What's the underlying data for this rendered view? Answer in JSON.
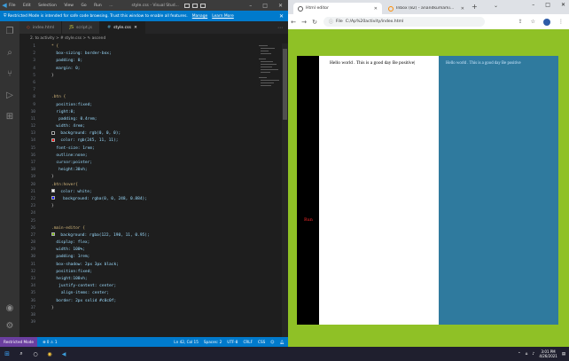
{
  "vscode": {
    "menu": [
      "File",
      "Edit",
      "Selection",
      "View",
      "Go",
      "Run",
      "..."
    ],
    "window_title": "style.css - Visual Stud...",
    "banner_text": "Restricted Mode is intended for safe code browsing. Trust this window to enable all features.",
    "banner_links": [
      "Manage",
      "Learn More"
    ],
    "tabs": [
      {
        "label": "index.html",
        "icon": "html-file-icon"
      },
      {
        "label": "script.js",
        "icon": "js-file-icon"
      },
      {
        "label": "style.css",
        "icon": "css-file-icon"
      }
    ],
    "breadcrumb": "2. to activity > # style.css > ✎ ascend",
    "code": [
      {
        "n": "1",
        "t": "* {",
        "k": "sel"
      },
      {
        "n": "2",
        "t": "  box-sizing: border-box;",
        "k": "prop"
      },
      {
        "n": "3",
        "t": "  padding: 0;",
        "k": "prop"
      },
      {
        "n": "4",
        "t": "  margin: 0;",
        "k": "prop"
      },
      {
        "n": "5",
        "t": "}",
        "k": "pun"
      },
      {
        "n": "6",
        "t": "",
        "k": "pun"
      },
      {
        "n": "7",
        "t": "",
        "k": "pun"
      },
      {
        "n": "8",
        "t": ".btn {",
        "k": "sel"
      },
      {
        "n": "9",
        "t": "  position:fixed;",
        "k": "prop"
      },
      {
        "n": "10",
        "t": "  right:0;",
        "k": "prop"
      },
      {
        "n": "11",
        "t": "   padding: 0.4rem;",
        "k": "prop"
      },
      {
        "n": "12",
        "t": "  width: 4rem;",
        "k": "prop"
      },
      {
        "n": "13",
        "t": "  background: rgb(0, 0, 0);",
        "k": "prop",
        "sw": "#000000"
      },
      {
        "n": "14",
        "t": "  color: rgb(245, 11, 11);",
        "k": "prop",
        "sw": "#f50b0b"
      },
      {
        "n": "15",
        "t": "  font-size: 1rem;",
        "k": "prop"
      },
      {
        "n": "16",
        "t": "  outline:none;",
        "k": "prop"
      },
      {
        "n": "17",
        "t": "  cursor:pointer;",
        "k": "prop"
      },
      {
        "n": "18",
        "t": "   height:30vh;",
        "k": "prop"
      },
      {
        "n": "19",
        "t": "}",
        "k": "pun"
      },
      {
        "n": "20",
        "t": ".btn:hover{",
        "k": "sel"
      },
      {
        "n": "21",
        "t": "  color: white;",
        "k": "prop",
        "sw": "#ffffff"
      },
      {
        "n": "22",
        "t": "   background: rgba(0, 0, 248, 0.884);",
        "k": "prop",
        "sw": "#0000f8"
      },
      {
        "n": "23",
        "t": "}",
        "k": "pun"
      },
      {
        "n": "24",
        "t": "",
        "k": "pun"
      },
      {
        "n": "25",
        "t": "",
        "k": "pun"
      },
      {
        "n": "26",
        "t": ".main-editor {",
        "k": "sel"
      },
      {
        "n": "27",
        "t": "  background: rgba(122, 190, 11, 0.95);",
        "k": "prop",
        "sw": "#7abe0b"
      },
      {
        "n": "28",
        "t": "  display: flex;",
        "k": "prop"
      },
      {
        "n": "29",
        "t": "  width: 100%;",
        "k": "prop"
      },
      {
        "n": "30",
        "t": "  padding: 1rem;",
        "k": "prop"
      },
      {
        "n": "31",
        "t": "  box-shadow: 2px 3px black;",
        "k": "prop"
      },
      {
        "n": "32",
        "t": "  position:fixed;",
        "k": "prop"
      },
      {
        "n": "33",
        "t": "  height:100vh;",
        "k": "prop"
      },
      {
        "n": "34",
        "t": "   justify-content: center;",
        "k": "prop"
      },
      {
        "n": "35",
        "t": "    align-items: center;",
        "k": "prop"
      },
      {
        "n": "36",
        "t": "  border: 2px solid #c0c0f;",
        "k": "prop"
      },
      {
        "n": "37",
        "t": "}",
        "k": "pun"
      },
      {
        "n": "38",
        "t": "",
        "k": "pun"
      },
      {
        "n": "39",
        "t": "",
        "k": "pun"
      }
    ],
    "status": {
      "mode": "Restricted Mode",
      "problems": "⊗ 0 ⚠ 1",
      "cursor": "Ln 42, Col 15",
      "spaces": "Spaces: 2",
      "encoding": "UTF-8",
      "eol": "CRLF",
      "language": "CSS"
    }
  },
  "chrome": {
    "tabs": [
      {
        "label": "Html editor"
      },
      {
        "label": "Inbox (82) - anandkumarki..."
      }
    ],
    "address": "C:/Ap%20activity/index.html",
    "address_prefix": "File"
  },
  "page": {
    "button_label": "Run",
    "white_text": "Hello world . This is a good day Be positive|",
    "blue_text": "Hello world . This is a good day Be positive"
  },
  "taskbar": {
    "time": "3:01 PM",
    "date": "4/26/2021"
  },
  "colors": {
    "vscode_bg": "#1e1e1e",
    "vscode_blue": "#007acc",
    "page_green": "#8fc126",
    "blue_panel": "#2f7a9e",
    "button_red": "#ff2a2a"
  }
}
